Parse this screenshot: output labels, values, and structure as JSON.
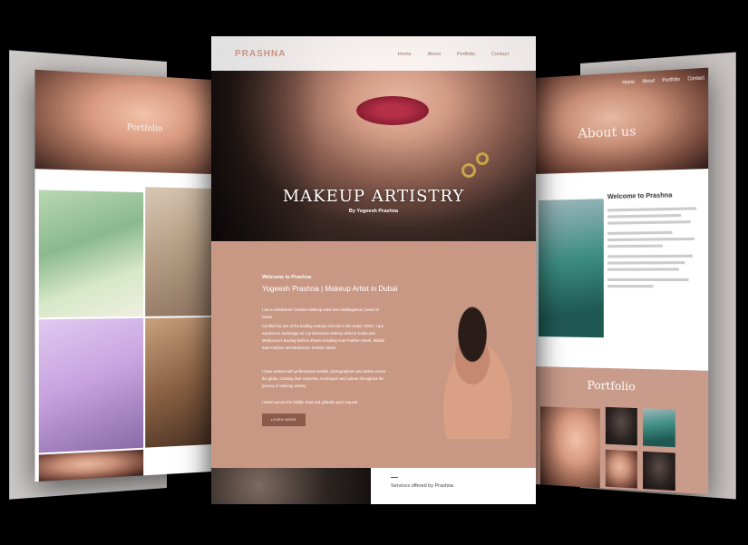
{
  "brand": {
    "logo": "PRASHNA",
    "accent": "#c89481",
    "about_bg": "#c99884"
  },
  "nav": {
    "items": [
      "Home",
      "About",
      "Portfolio",
      "Contact"
    ]
  },
  "hero": {
    "title": "MAKEUP ARTISTRY",
    "subtitle": "By Yogeesh Prashna"
  },
  "about": {
    "welcome": "Welcome to Prashna",
    "heading": "Yogeesh Prashna | Makeup Artist in Dubai",
    "paragraphs": [
      "I am a Goldsmoor Creative Makeup artist from Maldagascar, based in Dubai.",
      "Certified by one of the leading makeup schools in the world, ADDA, I got experience backstage as a professional makeup artist in Dubai and Melbourne's leading fashion shows including Arab Fashion Week, Middle East Fashion and Melbourne Fashion Week.",
      "I have worked with professional models, photographers and artists across the globe, curating their expertise, techniques and culture throughout the journey of makeup artistry.",
      "I travel across the Middle East and globally upon request."
    ],
    "button": "LEARN MORE"
  },
  "services": {
    "label": "Services offered by Prashna"
  },
  "right_panel": {
    "hero_title": "About us",
    "nav": [
      "Home",
      "About",
      "Portfolio",
      "Contact"
    ],
    "welcome": "Welcome to Prashna",
    "portfolio_title": "Portfolio"
  },
  "left_panel": {
    "hero_title": "Portfolio"
  }
}
